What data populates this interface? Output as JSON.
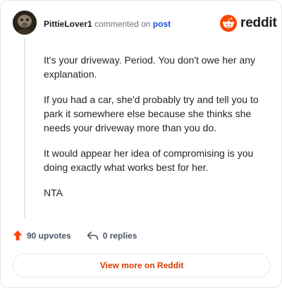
{
  "header": {
    "username": "PittieLover1",
    "commented_text": "commented on",
    "post_link": "post",
    "brand_word": "reddit"
  },
  "comment": {
    "paragraphs": [
      "It's your driveway. Period. You don't owe her any explanation.",
      "If you had a car, she'd probably try and tell you to park it somewhere else because she thinks she needs your driveway more than you do.",
      "It would appear her idea of compromising is you doing exactly what works best for her.",
      "NTA"
    ]
  },
  "actions": {
    "upvotes": "90 upvotes",
    "replies": "0 replies"
  },
  "footer": {
    "view_more": "View more on Reddit"
  },
  "colors": {
    "brand_orange": "#ff4500",
    "link_blue": "#1d4ed8",
    "view_more_text": "#d93a00"
  },
  "icons": {
    "upvote": "upvote-arrow-icon",
    "reply": "reply-arrow-icon",
    "brand": "reddit-snoo-icon"
  }
}
